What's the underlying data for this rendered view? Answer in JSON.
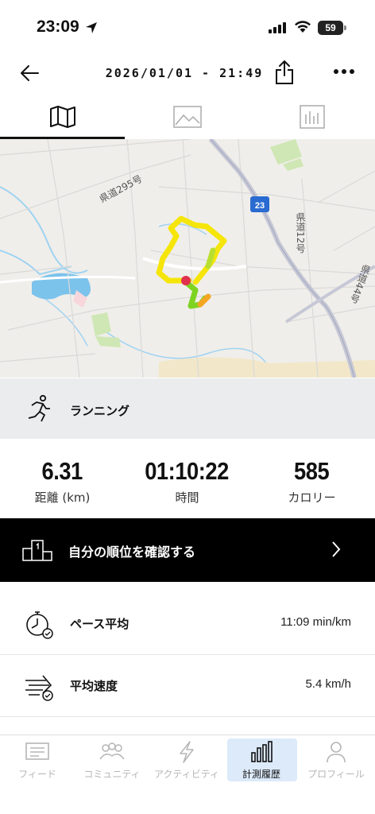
{
  "status_bar": {
    "time": "23:09",
    "battery": "59"
  },
  "header": {
    "title": "2026/01/01 - 21:49"
  },
  "tabs": [
    {
      "name": "map",
      "icon": "map-icon"
    },
    {
      "name": "photos",
      "icon": "image-icon"
    },
    {
      "name": "stats",
      "icon": "bar-chart-icon"
    }
  ],
  "map": {
    "labels": {
      "road_295": "県道295号",
      "road_12": "県道12号",
      "road_44": "県道44号",
      "route_23": "23"
    },
    "route_colors": {
      "main": "#f5e50a",
      "fast": "#7ed321",
      "slow": "#f5a623",
      "end": "#e0304e"
    }
  },
  "activity": {
    "label": "ランニング",
    "icon": "running-icon"
  },
  "stats": [
    {
      "value": "6.31",
      "label": "距離 (km)"
    },
    {
      "value": "01:10:22",
      "label": "時間"
    },
    {
      "value": "585",
      "label": "カロリー"
    }
  ],
  "ranking": {
    "label": "自分の順位を確認する"
  },
  "metrics": [
    {
      "label": "ペース平均",
      "value": "11:09 min/km",
      "icon": "stopwatch-icon"
    },
    {
      "label": "平均速度",
      "value": "5.4 km/h",
      "icon": "speed-icon"
    }
  ],
  "nav": [
    {
      "label": "フィード",
      "icon": "feed-icon"
    },
    {
      "label": "コミュニティ",
      "icon": "community-icon"
    },
    {
      "label": "アクティビティ",
      "icon": "activity-icon"
    },
    {
      "label": "計測履歴",
      "icon": "history-icon"
    },
    {
      "label": "プロフィール",
      "icon": "profile-icon"
    }
  ]
}
